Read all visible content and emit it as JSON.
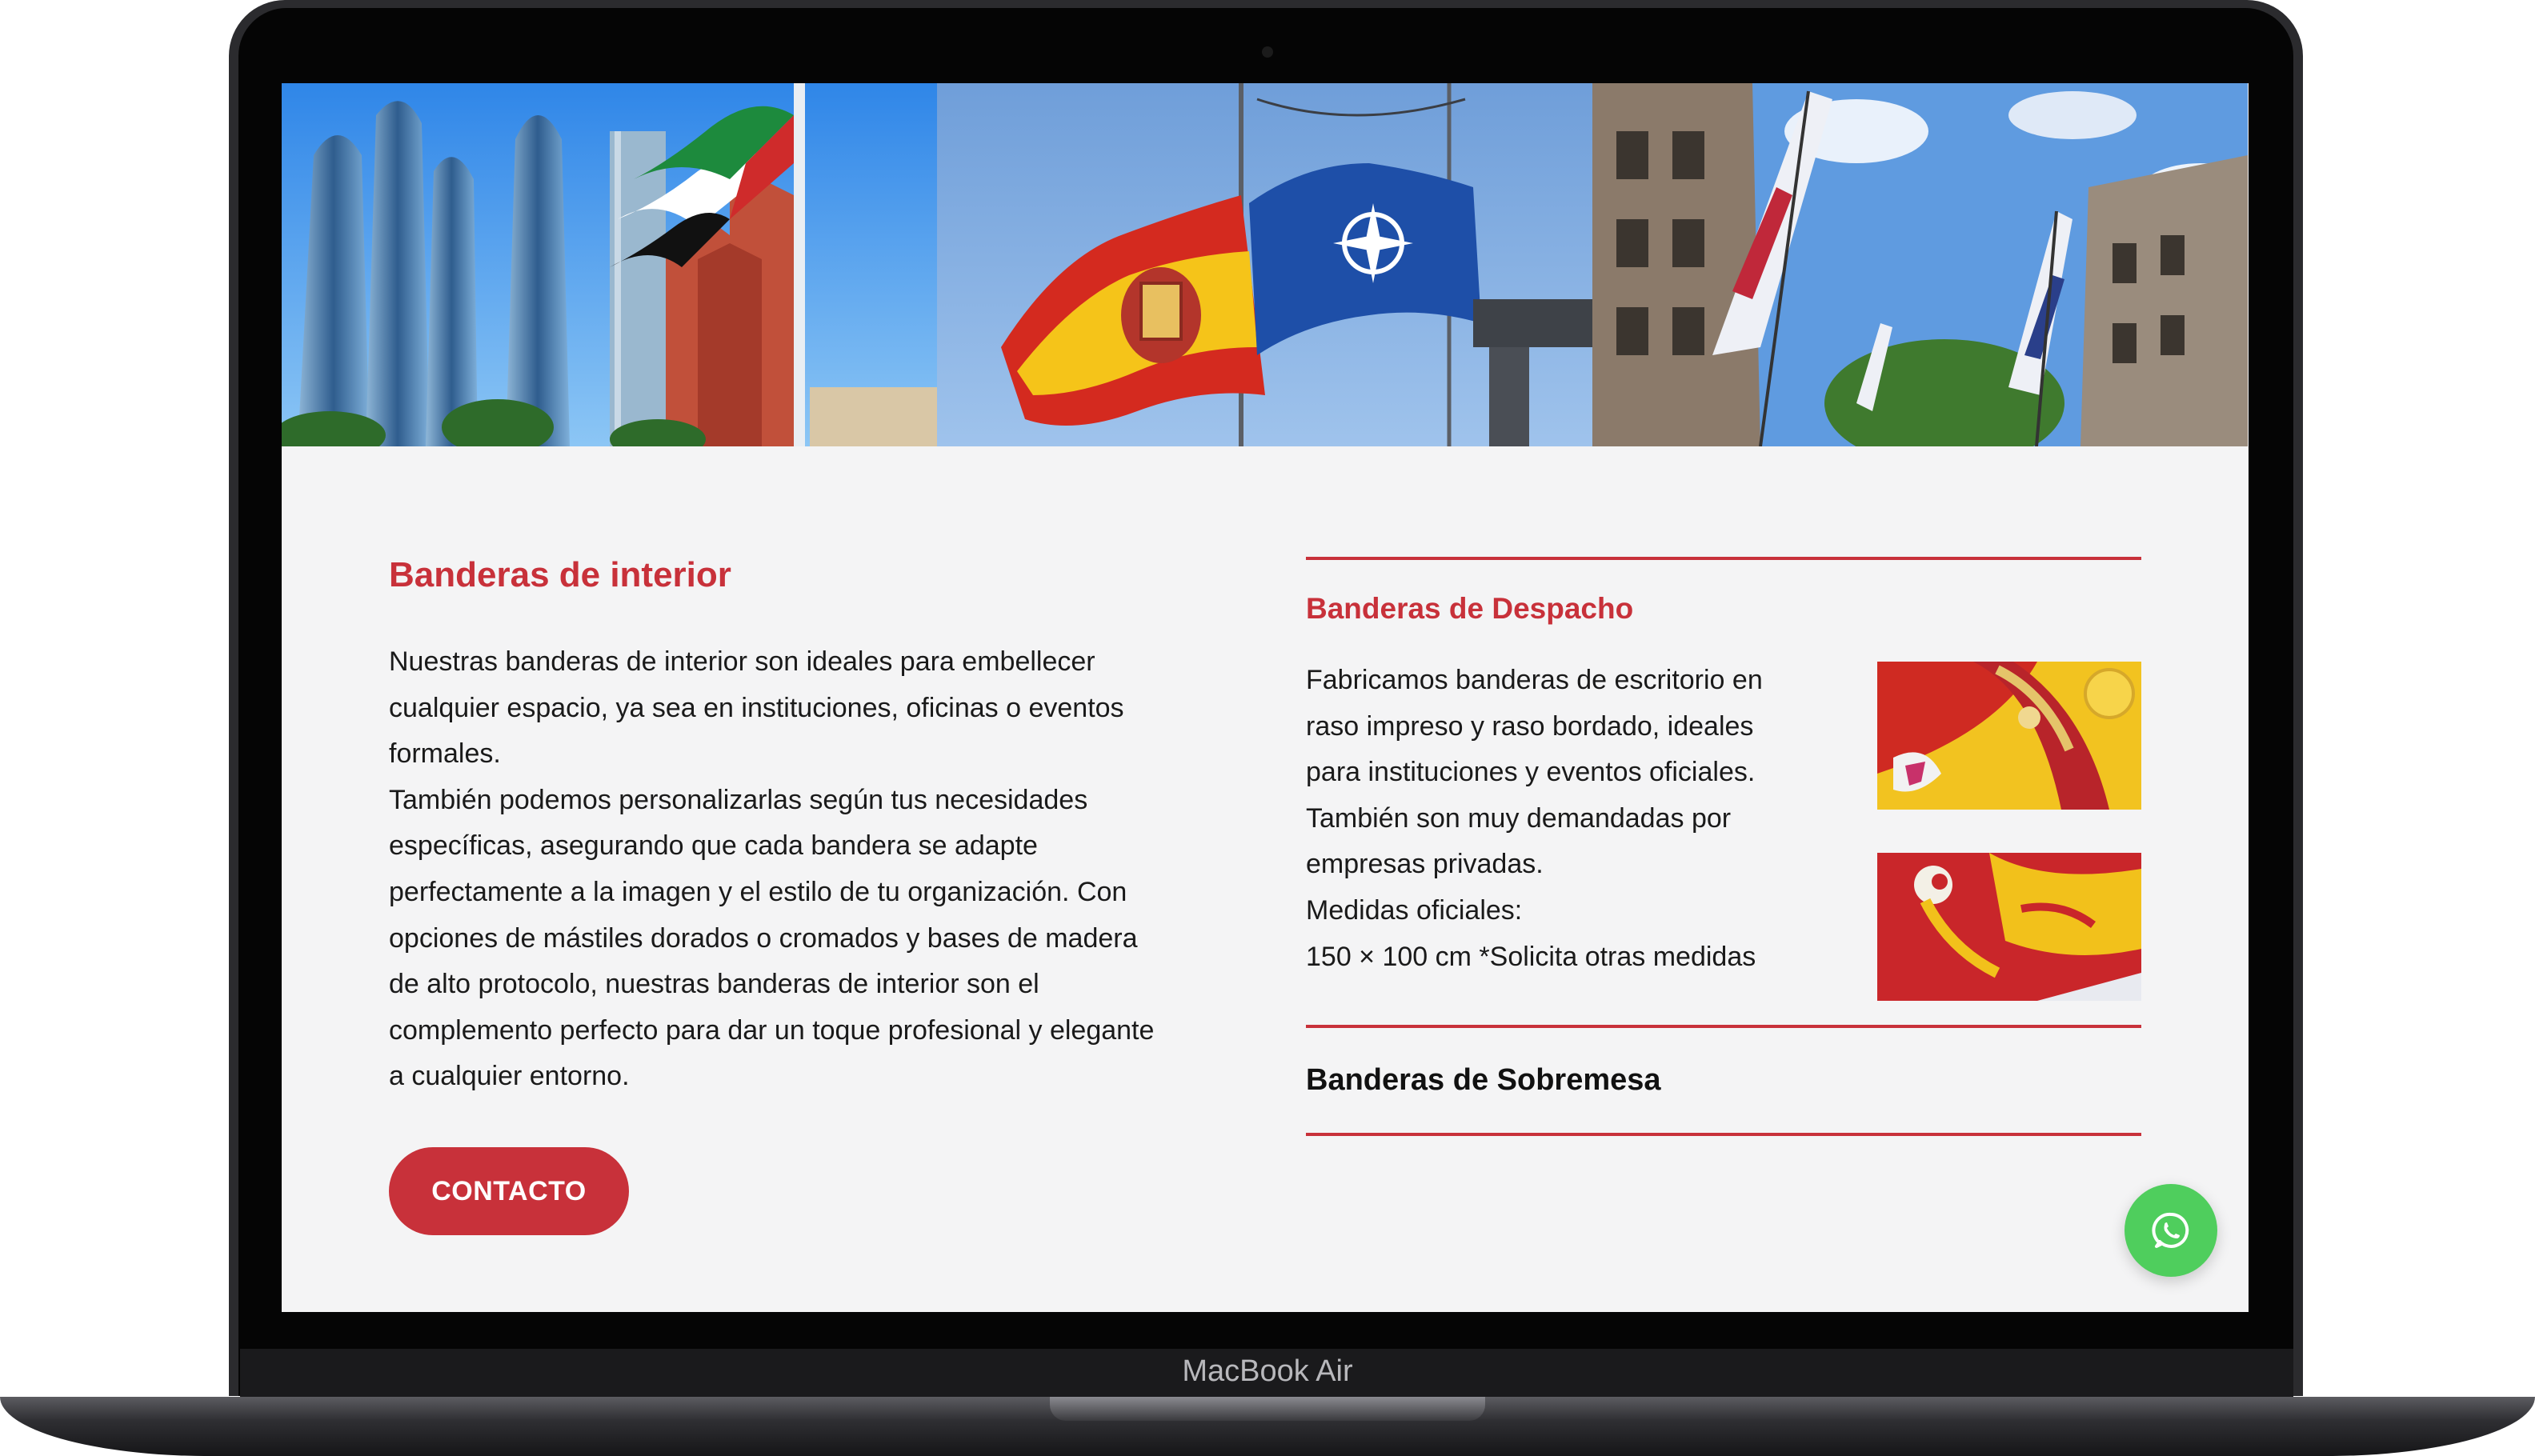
{
  "device": {
    "model_label": "MacBook Air"
  },
  "hero": {
    "images": [
      {
        "icon": "uae-flag-skyscrapers-photo"
      },
      {
        "icon": "spain-nato-flags-photo"
      },
      {
        "icon": "street-banners-photo"
      }
    ]
  },
  "interior": {
    "title": "Banderas de interior",
    "lines": [
      "Nuestras banderas de interior son ideales para embellecer",
      "cualquier espacio, ya sea en instituciones, oficinas o eventos",
      "formales.",
      "También podemos personalizarlas según tus necesidades",
      "específicas, asegurando que cada bandera se adapte",
      "perfectamente a la imagen y el estilo de tu organización. Con",
      "opciones de mástiles dorados o cromados y bases de madera",
      "de alto protocolo, nuestras banderas de interior son el",
      "complemento perfecto para dar un toque profesional y elegante",
      "a cualquier entorno."
    ],
    "button_label": "CONTACTO"
  },
  "accordion": {
    "items": [
      {
        "title": "Banderas de Despacho",
        "expanded": true,
        "lines": [
          "Fabricamos banderas de escritorio en",
          "raso impreso y raso bordado, ideales",
          "para instituciones y eventos oficiales.",
          "También son muy demandadas por",
          "empresas privadas.",
          "Medidas oficiales:",
          "150 × 100 cm  *Solicita otras medidas"
        ]
      },
      {
        "title": "Banderas de Sobremesa",
        "expanded": false
      }
    ]
  },
  "floating": {
    "icon": "whatsapp-icon"
  },
  "colors": {
    "accent": "#c8313a",
    "whatsapp": "#4fce5d",
    "page_bg": "#f4f4f5"
  }
}
